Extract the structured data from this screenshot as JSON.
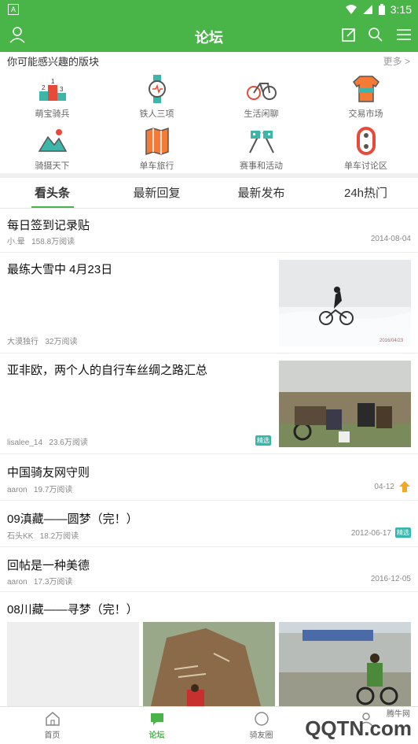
{
  "status": {
    "time": "3:15"
  },
  "header": {
    "title": "论坛"
  },
  "section": {
    "title": "你可能感兴趣的版块",
    "more": "更多 >"
  },
  "categories": [
    {
      "label": "萌宝骑兵",
      "icon": "podium-icon"
    },
    {
      "label": "铁人三项",
      "icon": "watch-icon"
    },
    {
      "label": "生活闲聊",
      "icon": "bicycle-icon"
    },
    {
      "label": "交易市场",
      "icon": "jersey-icon"
    },
    {
      "label": "骑摄天下",
      "icon": "mountain-photo-icon"
    },
    {
      "label": "单车旅行",
      "icon": "map-icon"
    },
    {
      "label": "赛事和活动",
      "icon": "checkered-flags-icon"
    },
    {
      "label": "单车讨论区",
      "icon": "bike-chain-icon"
    }
  ],
  "tabs": [
    {
      "label": "看头条"
    },
    {
      "label": "最新回复"
    },
    {
      "label": "最新发布"
    },
    {
      "label": "24h热门"
    }
  ],
  "posts": [
    {
      "title": "每日签到记录贴",
      "author": "小.晕",
      "reads": "158.8万阅读",
      "date": "2014-08-04"
    },
    {
      "title": "最练大雪中 4月23日",
      "author": "大漠独行",
      "reads": "32万阅读",
      "date": "",
      "thumb_caption": "2016/04/23"
    },
    {
      "title": "亚非欧，两个人的自行车丝绸之路汇总",
      "author": "lisalee_14",
      "reads": "23.6万阅读",
      "date": "",
      "badge": "精选"
    },
    {
      "title": "中国骑友网守则",
      "author": "aaron",
      "reads": "19.7万阅读",
      "date": "04-12",
      "badge": "置顶"
    },
    {
      "title": "09滇藏——圆梦（完！）",
      "author": "石头KK",
      "reads": "18.2万阅读",
      "date": "2012-06-17",
      "badge": "精选"
    },
    {
      "title": "回帖是一种美德",
      "author": "aaron",
      "reads": "17.3万阅读",
      "date": "2016-12-05"
    },
    {
      "title": "08川藏——寻梦（完！）",
      "author": "",
      "reads": "",
      "date": ""
    }
  ],
  "bottomnav": [
    {
      "label": "首页",
      "icon": "home-icon"
    },
    {
      "label": "论坛",
      "icon": "forum-icon"
    },
    {
      "label": "骑友圈",
      "icon": "friends-icon"
    },
    {
      "label": "",
      "icon": "user-icon"
    }
  ],
  "watermark": {
    "text": "QQTN.com",
    "sub": "腾牛网"
  },
  "colors": {
    "primary": "#49b548",
    "badge": "#36b7ad",
    "pin": "#f5a623"
  }
}
